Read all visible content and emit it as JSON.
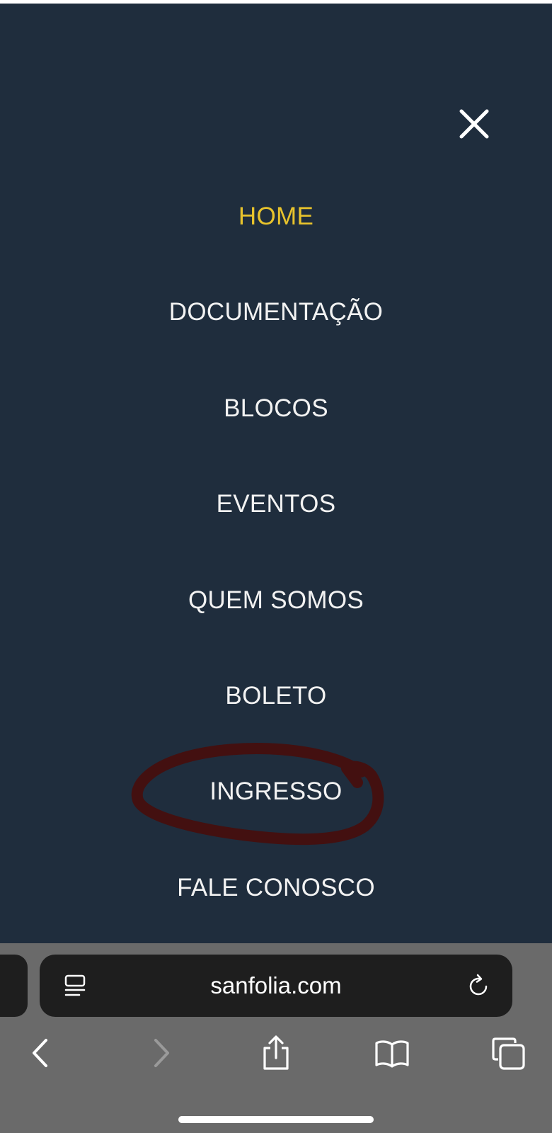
{
  "menu": {
    "items": [
      {
        "label": "HOME",
        "active": true
      },
      {
        "label": "DOCUMENTAÇÃO",
        "active": false
      },
      {
        "label": "BLOCOS",
        "active": false
      },
      {
        "label": "EVENTOS",
        "active": false
      },
      {
        "label": "QUEM SOMOS",
        "active": false
      },
      {
        "label": "BOLETO",
        "active": false
      },
      {
        "label": "INGRESSO",
        "active": false
      },
      {
        "label": "FALE CONOSCO",
        "active": false
      }
    ],
    "close_icon": "close-icon",
    "colors": {
      "background": "#1f2d3d",
      "item_text": "#f2f2f2",
      "active_item": "#e8c32c",
      "highlight_scribble": "#4a0c08"
    }
  },
  "browser": {
    "url": "sanfolia.com",
    "icons": {
      "reader": "reader-icon",
      "reload": "reload-icon",
      "back": "back-icon",
      "forward": "forward-icon",
      "share": "share-icon",
      "bookmarks": "bookmarks-icon",
      "tabs": "tabs-icon"
    },
    "colors": {
      "toolbar": "#6a6a6a",
      "address_bar": "#1e1e1e"
    }
  }
}
